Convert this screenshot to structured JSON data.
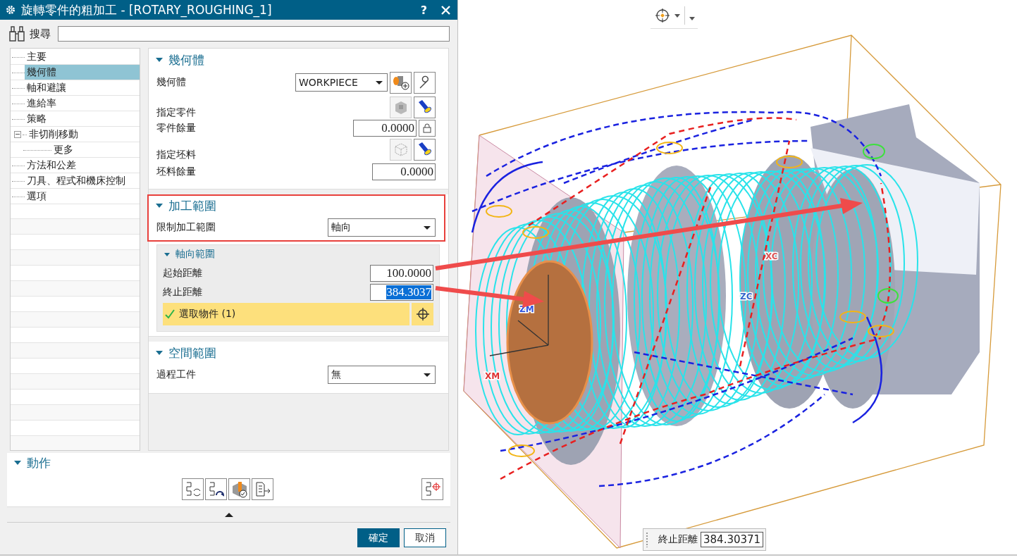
{
  "window": {
    "title": "旋轉零件的粗加工 - [ROTARY_ROUGHING_1]",
    "help": "?"
  },
  "search": {
    "label": "搜尋"
  },
  "tree": [
    {
      "label": "主要",
      "selected": false
    },
    {
      "label": "幾何體",
      "selected": true
    },
    {
      "label": "軸和避讓",
      "selected": false
    },
    {
      "label": "進給率",
      "selected": false
    },
    {
      "label": "策略",
      "selected": false
    },
    {
      "label": "非切削移動",
      "selected": false,
      "expanded": true,
      "children": [
        {
          "label": "更多",
          "selected": false
        }
      ]
    },
    {
      "label": "方法和公差",
      "selected": false
    },
    {
      "label": "刀具、程式和機床控制",
      "selected": false
    },
    {
      "label": "選項",
      "selected": false
    }
  ],
  "sections": [
    {
      "title": "幾何體",
      "highlighted": false,
      "rows": [
        {
          "kind": "geometry",
          "label": "幾何體",
          "value": "WORKPIECE"
        },
        {
          "kind": "part",
          "label": "指定零件"
        },
        {
          "kind": "locked-number",
          "label": "零件餘量",
          "value": "0.0000"
        },
        {
          "kind": "blank",
          "label": "指定坯料"
        },
        {
          "kind": "number",
          "label": "坯料餘量",
          "value": "0.0000"
        }
      ]
    },
    {
      "title": "加工範圍",
      "highlighted": true,
      "rows": [
        {
          "kind": "select",
          "label": "限制加工範圍",
          "value": "軸向"
        }
      ],
      "group": {
        "title": "軸向範圍",
        "rows": [
          {
            "label": "起始距離",
            "value": "100.0000",
            "selected": false
          },
          {
            "label": "終止距離",
            "value": "384.3037",
            "selected": true
          }
        ],
        "selection": {
          "label": "選取物件 (1)",
          "done": true
        }
      }
    },
    {
      "title": "空間範圍",
      "highlighted": false,
      "rows": [
        {
          "kind": "select",
          "label": "過程工件",
          "value": "無"
        }
      ]
    }
  ],
  "actions": {
    "title": "動作"
  },
  "buttons": [
    {
      "label": "確定",
      "primary": true
    },
    {
      "label": "取消",
      "primary": false
    }
  ],
  "viewport": {
    "axis_labels": [
      {
        "text": "ZM",
        "color": "#3355dd"
      },
      {
        "text": "XM",
        "color": "#dd3333"
      },
      {
        "text": "XC",
        "color": "#dd5555"
      },
      {
        "text": "ZC",
        "color": "#3366cc"
      }
    ],
    "readout": {
      "label": "終止距離",
      "value": "384.30371"
    }
  }
}
